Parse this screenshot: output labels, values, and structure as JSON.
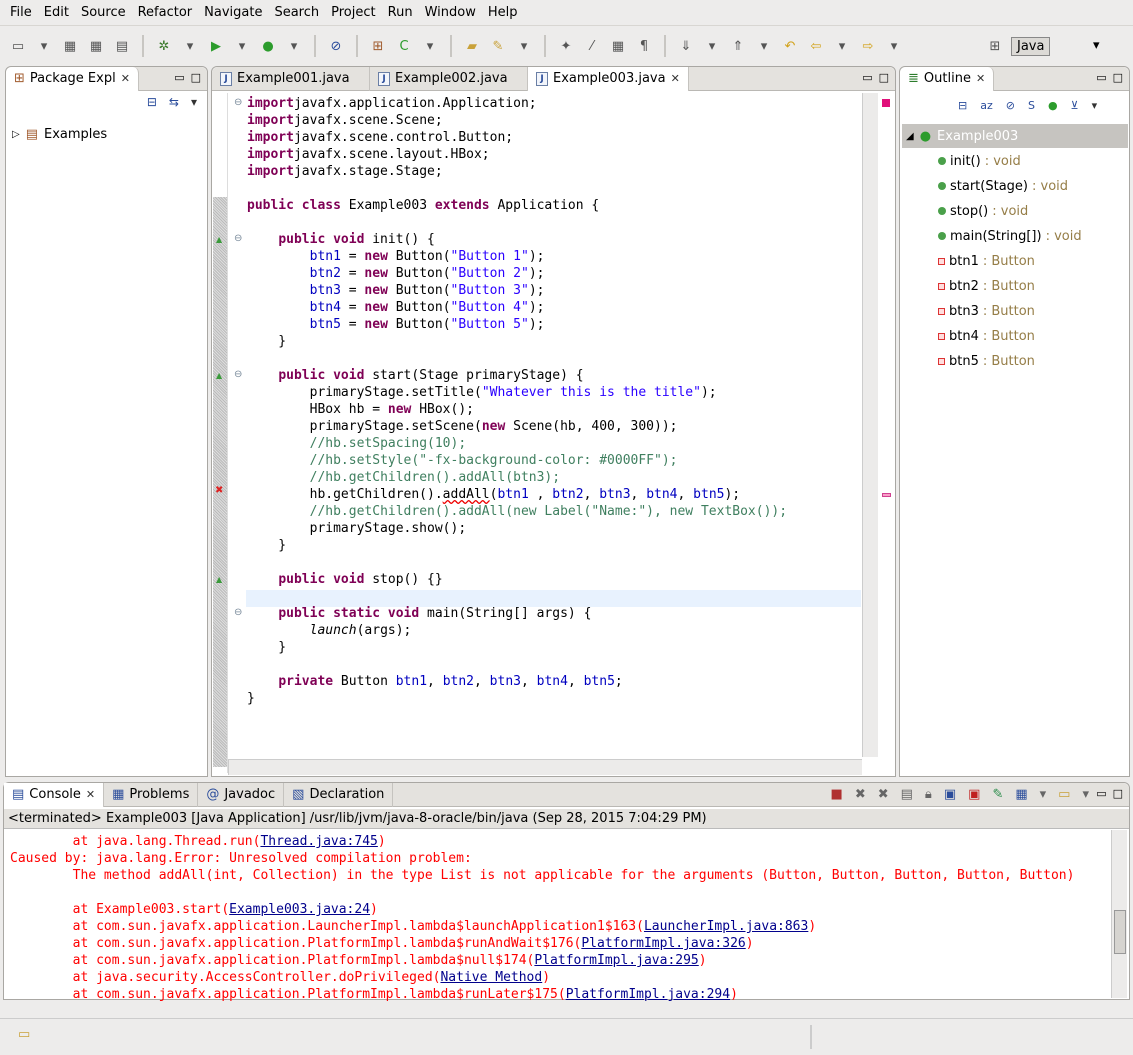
{
  "menu": [
    "File",
    "Edit",
    "Source",
    "Refactor",
    "Navigate",
    "Search",
    "Project",
    "Run",
    "Window",
    "Help"
  ],
  "perspective": {
    "label": "Java"
  },
  "package_explorer": {
    "title": "Package Expl",
    "tree": [
      {
        "label": "Examples"
      }
    ]
  },
  "editor": {
    "tabs": [
      {
        "label": "Example001.java"
      },
      {
        "label": "Example002.java"
      },
      {
        "label": "Example003.java",
        "active": true
      }
    ],
    "lines": [
      [
        [
          "kw",
          "import"
        ],
        [
          "",
          "javafx.application.Application;"
        ]
      ],
      [
        [
          "kw",
          "import"
        ],
        [
          "",
          "javafx.scene.Scene;"
        ]
      ],
      [
        [
          "kw",
          "import"
        ],
        [
          "",
          "javafx.scene.control.Button;"
        ]
      ],
      [
        [
          "kw",
          "import"
        ],
        [
          "",
          "javafx.scene.layout.HBox;"
        ]
      ],
      [
        [
          "kw",
          "import"
        ],
        [
          "",
          "javafx.stage.Stage;"
        ]
      ],
      [],
      [
        [
          "kw",
          "public class"
        ],
        [
          "",
          " Example003 "
        ],
        [
          "kw",
          "extends"
        ],
        [
          "",
          " Application {"
        ]
      ],
      [],
      [
        [
          "",
          "    "
        ],
        [
          "kw",
          "public void"
        ],
        [
          "",
          " init() {"
        ]
      ],
      [
        [
          "",
          "        "
        ],
        [
          "fld",
          "btn1"
        ],
        [
          "",
          " = "
        ],
        [
          "kw",
          "new"
        ],
        [
          "",
          " Button("
        ],
        [
          "str",
          "\"Button 1\""
        ],
        [
          "",
          ");"
        ]
      ],
      [
        [
          "",
          "        "
        ],
        [
          "fld",
          "btn2"
        ],
        [
          "",
          " = "
        ],
        [
          "kw",
          "new"
        ],
        [
          "",
          " Button("
        ],
        [
          "str",
          "\"Button 2\""
        ],
        [
          "",
          ");"
        ]
      ],
      [
        [
          "",
          "        "
        ],
        [
          "fld",
          "btn3"
        ],
        [
          "",
          " = "
        ],
        [
          "kw",
          "new"
        ],
        [
          "",
          " Button("
        ],
        [
          "str",
          "\"Button 3\""
        ],
        [
          "",
          ");"
        ]
      ],
      [
        [
          "",
          "        "
        ],
        [
          "fld",
          "btn4"
        ],
        [
          "",
          " = "
        ],
        [
          "kw",
          "new"
        ],
        [
          "",
          " Button("
        ],
        [
          "str",
          "\"Button 4\""
        ],
        [
          "",
          ");"
        ]
      ],
      [
        [
          "",
          "        "
        ],
        [
          "fld",
          "btn5"
        ],
        [
          "",
          " = "
        ],
        [
          "kw",
          "new"
        ],
        [
          "",
          " Button("
        ],
        [
          "str",
          "\"Button 5\""
        ],
        [
          "",
          ");"
        ]
      ],
      [
        [
          "",
          "    }"
        ]
      ],
      [],
      [
        [
          "",
          "    "
        ],
        [
          "kw",
          "public void"
        ],
        [
          "",
          " start(Stage primaryStage) {"
        ]
      ],
      [
        [
          "",
          "        primaryStage.setTitle("
        ],
        [
          "str",
          "\"Whatever this is the title\""
        ],
        [
          "",
          ");"
        ]
      ],
      [
        [
          "",
          "        HBox hb = "
        ],
        [
          "kw",
          "new"
        ],
        [
          "",
          " HBox();"
        ]
      ],
      [
        [
          "",
          "        primaryStage.setScene("
        ],
        [
          "kw",
          "new"
        ],
        [
          "",
          " Scene(hb, 400, 300));"
        ]
      ],
      [
        [
          "",
          "        "
        ],
        [
          "cm",
          "//hb.setSpacing(10);"
        ]
      ],
      [
        [
          "",
          "        "
        ],
        [
          "cm",
          "//hb.setStyle(\"-fx-background-color: #0000FF\");"
        ]
      ],
      [
        [
          "",
          "        "
        ],
        [
          "cm",
          "//hb.getChildren().addAll(btn3);"
        ]
      ],
      [
        [
          "",
          "        hb.getChildren()."
        ],
        [
          "err",
          "addAll"
        ],
        [
          "",
          "("
        ],
        [
          "fld",
          "btn1"
        ],
        [
          "",
          " , "
        ],
        [
          "fld",
          "btn2"
        ],
        [
          "",
          ", "
        ],
        [
          "fld",
          "btn3"
        ],
        [
          "",
          ", "
        ],
        [
          "fld",
          "btn4"
        ],
        [
          "",
          ", "
        ],
        [
          "fld",
          "btn5"
        ],
        [
          "",
          ");"
        ]
      ],
      [
        [
          "",
          "        "
        ],
        [
          "cm",
          "//hb.getChildren().addAll(new Label(\"Name:\"), new TextBox());"
        ]
      ],
      [
        [
          "",
          "        primaryStage.show();"
        ]
      ],
      [
        [
          "",
          "    }"
        ]
      ],
      [],
      [
        [
          "",
          "    "
        ],
        [
          "kw",
          "public void"
        ],
        [
          "",
          " stop() {}"
        ]
      ],
      [],
      [
        [
          "",
          "    "
        ],
        [
          "kw",
          "public static void"
        ],
        [
          "",
          " main(String[] args) {"
        ]
      ],
      [
        [
          "",
          "        "
        ],
        [
          "it",
          "launch"
        ],
        [
          "",
          "(args);"
        ]
      ],
      [
        [
          "",
          "    }"
        ]
      ],
      [],
      [
        [
          "",
          "    "
        ],
        [
          "kw",
          "private"
        ],
        [
          "",
          " Button "
        ],
        [
          "fld",
          "btn1"
        ],
        [
          "",
          ", "
        ],
        [
          "fld",
          "btn2"
        ],
        [
          "",
          ", "
        ],
        [
          "fld",
          "btn3"
        ],
        [
          "",
          ", "
        ],
        [
          "fld",
          "btn4"
        ],
        [
          "",
          ", "
        ],
        [
          "fld",
          "btn5"
        ],
        [
          "",
          ";"
        ]
      ],
      [
        [
          "",
          "}"
        ]
      ]
    ]
  },
  "outline": {
    "title": "Outline",
    "root": "Example003",
    "items": [
      {
        "name": "init()",
        "type": " : void",
        "kind": "method"
      },
      {
        "name": "start(Stage)",
        "type": " : void",
        "kind": "method-error"
      },
      {
        "name": "stop()",
        "type": " : void",
        "kind": "method"
      },
      {
        "name": "main(String[])",
        "type": " : void",
        "kind": "static-method"
      },
      {
        "name": "btn1",
        "type": " : Button",
        "kind": "field"
      },
      {
        "name": "btn2",
        "type": " : Button",
        "kind": "field"
      },
      {
        "name": "btn3",
        "type": " : Button",
        "kind": "field"
      },
      {
        "name": "btn4",
        "type": " : Button",
        "kind": "field"
      },
      {
        "name": "btn5",
        "type": " : Button",
        "kind": "field"
      }
    ]
  },
  "console": {
    "tabs": [
      {
        "label": "Console",
        "active": true
      },
      {
        "label": "Problems"
      },
      {
        "label": "Javadoc"
      },
      {
        "label": "Declaration"
      }
    ],
    "header": "<terminated> Example003 [Java Application] /usr/lib/jvm/java-8-oracle/bin/java (Sep 28, 2015 7:04:29 PM)",
    "lines": [
      [
        "        at java.lang.Thread.run(",
        "Thread.java:745",
        ")"
      ],
      [
        "Caused by: java.lang.Error: Unresolved compilation problem: ",
        "",
        ""
      ],
      [
        "        The method addAll(int, Collection) in the type List is not applicable for the arguments (Button, Button, Button, Button, Button)",
        "",
        ""
      ],
      [
        "",
        "",
        ""
      ],
      [
        "        at Example003.start(",
        "Example003.java:24",
        ")"
      ],
      [
        "        at com.sun.javafx.application.LauncherImpl.lambda$launchApplication1$163(",
        "LauncherImpl.java:863",
        ")"
      ],
      [
        "        at com.sun.javafx.application.PlatformImpl.lambda$runAndWait$176(",
        "PlatformImpl.java:326",
        ")"
      ],
      [
        "        at com.sun.javafx.application.PlatformImpl.lambda$null$174(",
        "PlatformImpl.java:295",
        ")"
      ],
      [
        "        at java.security.AccessController.doPrivileged(",
        "Native Method",
        ")"
      ],
      [
        "        at com.sun.javafx.application.PlatformImpl.lambda$runLater$175(",
        "PlatformImpl.java:294",
        ")"
      ]
    ]
  },
  "colors": {
    "keyword": "#7f0055",
    "string": "#2a00ff",
    "comment": "#3f7f5f",
    "field": "#0000c0",
    "console_error": "#ff0000",
    "link": "#01018c"
  }
}
